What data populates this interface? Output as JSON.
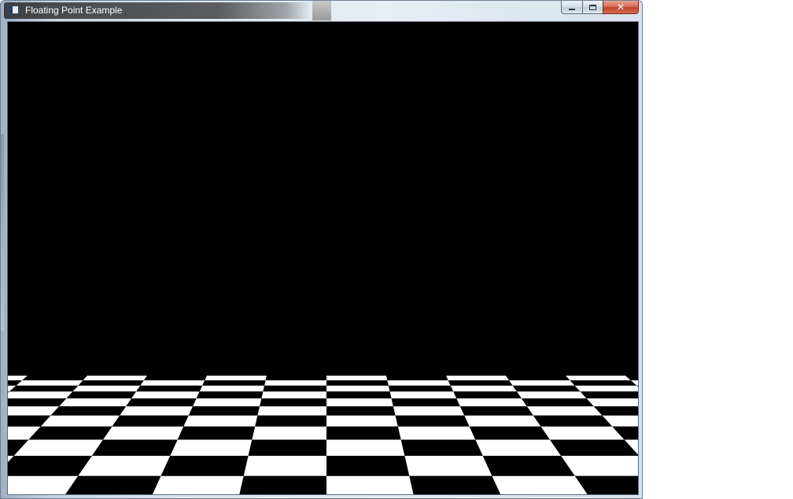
{
  "window": {
    "title": "Floating Point Example",
    "icon": "app-window-icon"
  },
  "caption_buttons": {
    "minimize_icon": "minimize-icon",
    "maximize_icon": "maximize-icon",
    "close_icon": "close-icon",
    "close_glyph": "✕"
  },
  "scene": {
    "background_color": "#000000",
    "floor_colors": [
      "#ffffff",
      "#000000"
    ],
    "description_type": "3d-checkerboard-floor"
  }
}
